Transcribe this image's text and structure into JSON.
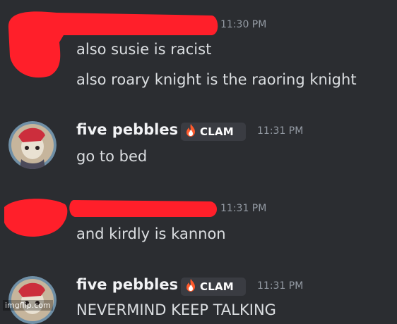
{
  "colors": {
    "background": "#2b2d31",
    "redaction": "#ff1f2a",
    "username": "#f2f3f5",
    "message_text": "#dbdee1",
    "timestamp": "#949ba4",
    "tag_bg": "#3a3c42"
  },
  "messages": [
    {
      "author": "",
      "timestamp": "11:30 PM",
      "lines": [
        "also susie is racist",
        "also roary knight is the raoring knight"
      ]
    },
    {
      "author": "five pebbles",
      "tag": {
        "icon": "fire-icon",
        "label": "CLAM"
      },
      "timestamp": "11:31 PM",
      "lines": [
        "go to bed"
      ]
    },
    {
      "author": "",
      "timestamp": "11:31 PM",
      "lines": [
        "and kirdly is kannon"
      ]
    },
    {
      "author": "five pebbles",
      "tag": {
        "icon": "fire-icon",
        "label": "CLAM"
      },
      "timestamp": "11:31 PM",
      "lines": [
        "NEVERMIND KEEP TALKING"
      ]
    }
  ],
  "watermark": "imgflip.com"
}
